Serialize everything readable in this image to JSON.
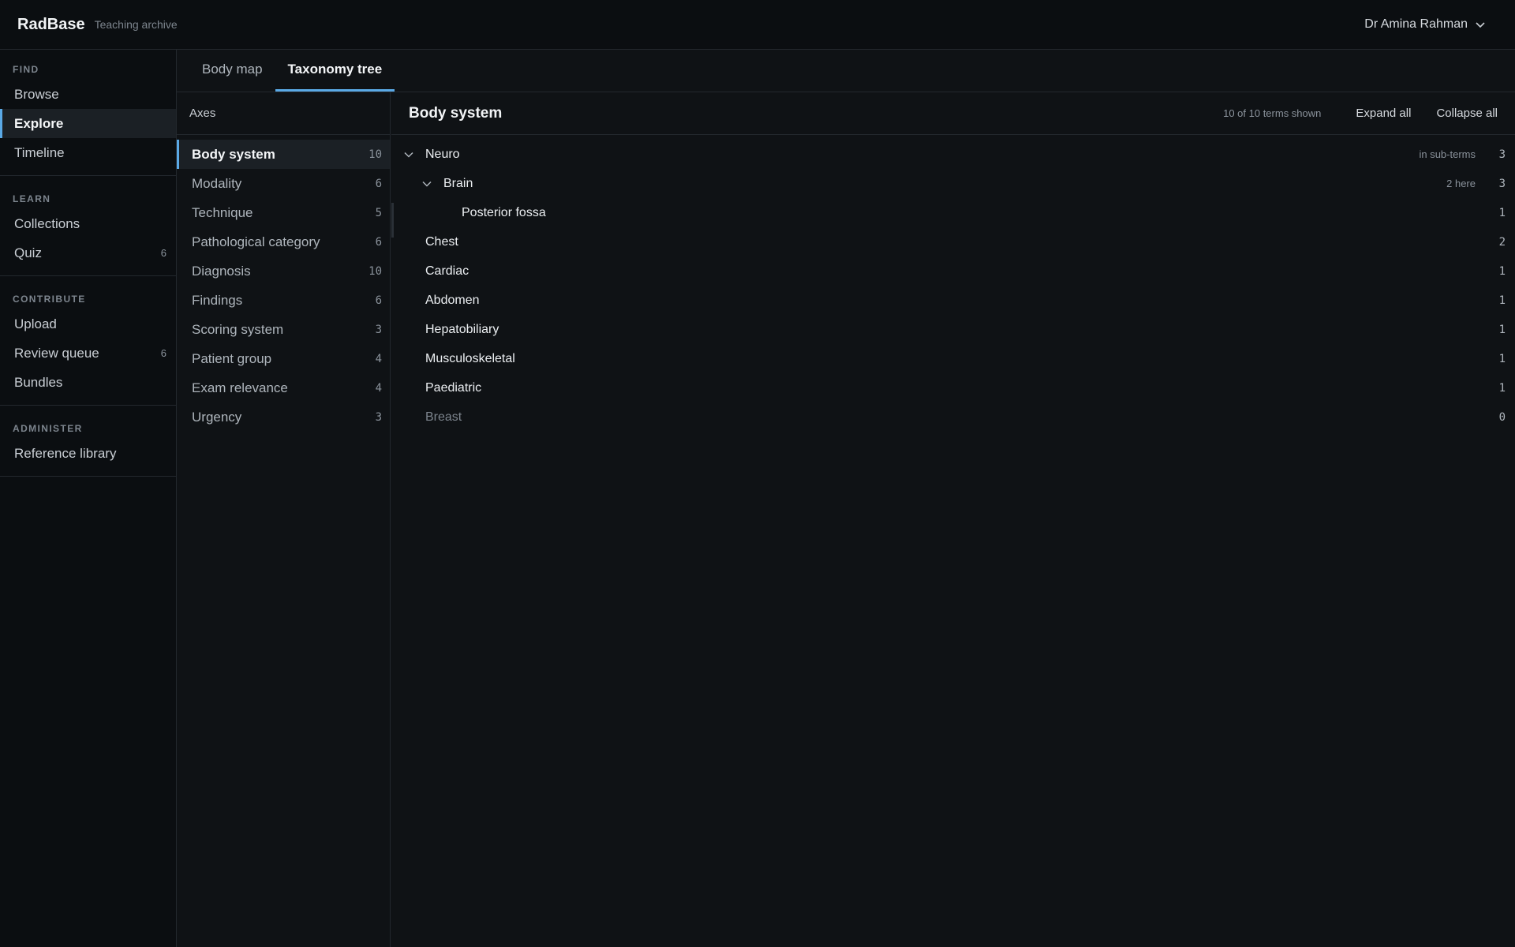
{
  "app": {
    "brand": "RadBase",
    "subtitle": "Teaching archive",
    "user": "Dr Amina Rahman"
  },
  "sidebar": {
    "sections": [
      {
        "heading": "FIND",
        "items": [
          {
            "label": "Browse",
            "count": ""
          },
          {
            "label": "Explore",
            "count": "",
            "active": true
          },
          {
            "label": "Timeline",
            "count": ""
          }
        ]
      },
      {
        "heading": "LEARN",
        "items": [
          {
            "label": "Collections",
            "count": ""
          },
          {
            "label": "Quiz",
            "count": "6"
          }
        ]
      },
      {
        "heading": "CONTRIBUTE",
        "items": [
          {
            "label": "Upload",
            "count": ""
          },
          {
            "label": "Review queue",
            "count": "6"
          },
          {
            "label": "Bundles",
            "count": ""
          }
        ]
      },
      {
        "heading": "ADMINISTER",
        "items": [
          {
            "label": "Reference library",
            "count": ""
          }
        ]
      }
    ]
  },
  "tabs": [
    {
      "label": "Body map",
      "active": false
    },
    {
      "label": "Taxonomy tree",
      "active": true
    }
  ],
  "axes": {
    "heading": "Axes",
    "items": [
      {
        "label": "Body system",
        "count": "10",
        "active": true
      },
      {
        "label": "Modality",
        "count": "6"
      },
      {
        "label": "Technique",
        "count": "5"
      },
      {
        "label": "Pathological category",
        "count": "6"
      },
      {
        "label": "Diagnosis",
        "count": "10"
      },
      {
        "label": "Findings",
        "count": "6"
      },
      {
        "label": "Scoring system",
        "count": "3"
      },
      {
        "label": "Patient group",
        "count": "4"
      },
      {
        "label": "Exam relevance",
        "count": "4"
      },
      {
        "label": "Urgency",
        "count": "3"
      }
    ]
  },
  "tree": {
    "title": "Body system",
    "shown": "10 of 10 terms shown",
    "expand_label": "Expand all",
    "collapse_label": "Collapse all",
    "rows": [
      {
        "term": "Neuro",
        "level": 0,
        "expanded": true,
        "note": "in sub-terms",
        "count": "3"
      },
      {
        "term": "Brain",
        "level": 1,
        "expanded": true,
        "note": "2 here",
        "count": "3"
      },
      {
        "term": "Posterior fossa",
        "level": 2,
        "note": "",
        "count": "1"
      },
      {
        "term": "Chest",
        "level": 0,
        "note": "",
        "count": "2"
      },
      {
        "term": "Cardiac",
        "level": 0,
        "note": "",
        "count": "1"
      },
      {
        "term": "Abdomen",
        "level": 0,
        "note": "",
        "count": "1"
      },
      {
        "term": "Hepatobiliary",
        "level": 0,
        "note": "",
        "count": "1"
      },
      {
        "term": "Musculoskeletal",
        "level": 0,
        "note": "",
        "count": "1"
      },
      {
        "term": "Paediatric",
        "level": 0,
        "note": "",
        "count": "1"
      },
      {
        "term": "Breast",
        "level": 0,
        "note": "",
        "count": "0",
        "muted": true
      }
    ]
  }
}
